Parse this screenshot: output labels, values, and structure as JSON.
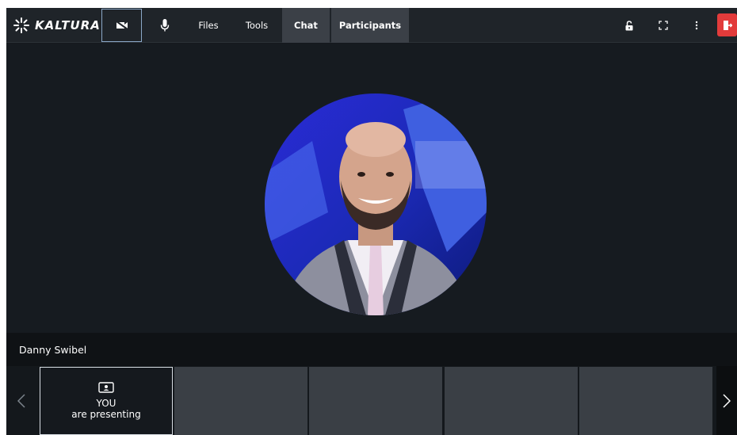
{
  "brand": {
    "logo_text": "KALTURA"
  },
  "toolbar": {
    "camera_button": "camera-off",
    "mic_button": "microphone",
    "files_label": "Files",
    "tools_label": "Tools",
    "chat_label": "Chat",
    "participants_label": "Participants",
    "chat_active": true,
    "participants_active": true
  },
  "right_controls": [
    "lock-icon",
    "fullscreen-icon",
    "more-icon",
    "exit-icon"
  ],
  "speaker": {
    "name": "Danny Swibel"
  },
  "filmstrip": {
    "self_tile": {
      "line1": "YOU",
      "line2": "are presenting"
    },
    "empty_tiles": 4
  },
  "colors": {
    "exit": "#e23b3b",
    "active_tab": "#3b4047",
    "stage": "#161b20",
    "selected_border": "#8ba8c8"
  }
}
